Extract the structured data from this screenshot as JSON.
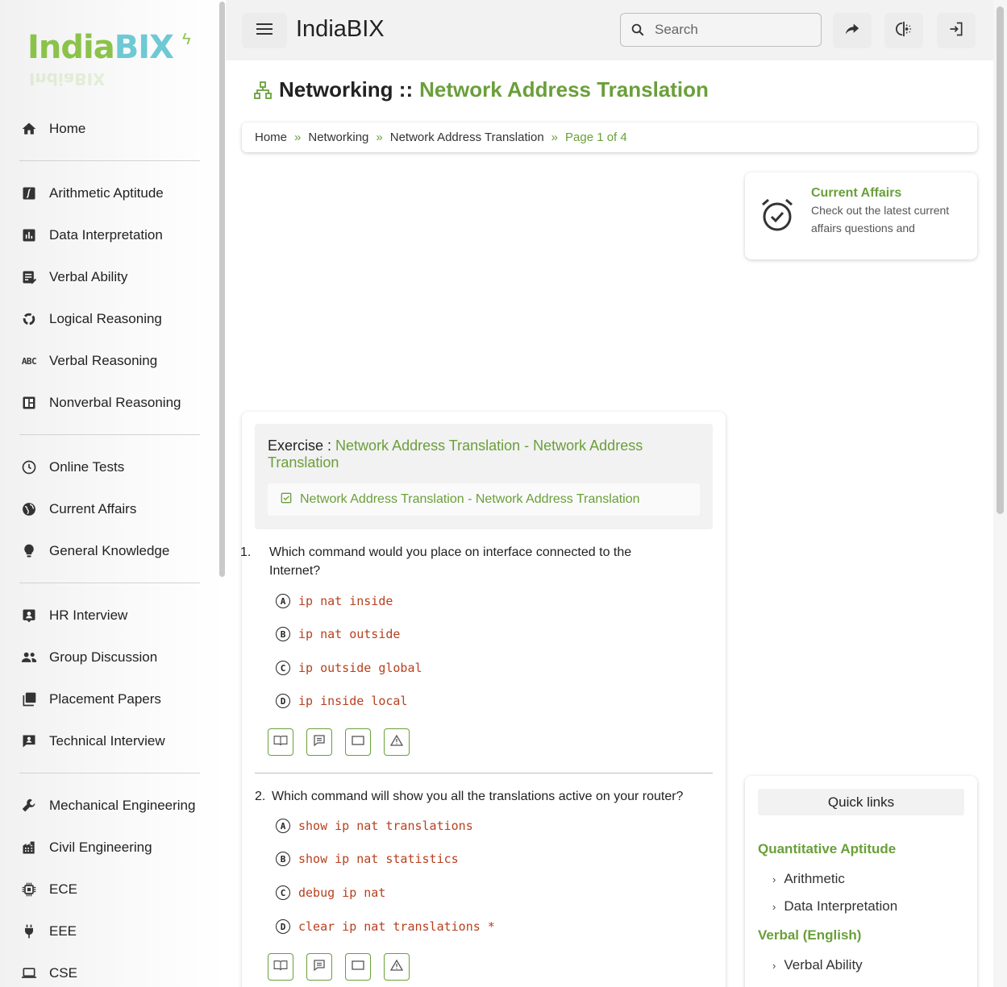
{
  "brand": {
    "logo_part1": "India",
    "logo_part2": "BIX",
    "name": "IndiaBIX"
  },
  "search": {
    "placeholder": "Search"
  },
  "sidebar": {
    "groups": [
      [
        {
          "label": "Home",
          "icon": "home-icon"
        }
      ],
      [
        {
          "label": "Arithmetic Aptitude",
          "icon": "function-icon"
        },
        {
          "label": "Data Interpretation",
          "icon": "bar-chart-icon"
        },
        {
          "label": "Verbal Ability",
          "icon": "checklist-icon"
        },
        {
          "label": "Logical Reasoning",
          "icon": "cycle-icon"
        },
        {
          "label": "Verbal Reasoning",
          "icon": "abc-icon"
        },
        {
          "label": "Nonverbal Reasoning",
          "icon": "dashboard-icon"
        }
      ],
      [
        {
          "label": "Online Tests",
          "icon": "clock-icon"
        },
        {
          "label": "Current Affairs",
          "icon": "globe-icon"
        },
        {
          "label": "General Knowledge",
          "icon": "lightbulb-icon"
        }
      ],
      [
        {
          "label": "HR Interview",
          "icon": "contact-icon"
        },
        {
          "label": "Group Discussion",
          "icon": "group-icon"
        },
        {
          "label": "Placement Papers",
          "icon": "library-icon"
        },
        {
          "label": "Technical Interview",
          "icon": "interview-icon"
        }
      ],
      [
        {
          "label": "Mechanical Engineering",
          "icon": "wrench-icon"
        },
        {
          "label": "Civil Engineering",
          "icon": "building-icon"
        },
        {
          "label": "ECE",
          "icon": "chip-icon"
        },
        {
          "label": "EEE",
          "icon": "plug-icon"
        },
        {
          "label": "CSE",
          "icon": "laptop-icon"
        }
      ]
    ]
  },
  "page": {
    "title_prefix": "Networking ::",
    "title_topic": "Network Address Translation",
    "breadcrumb": [
      "Home",
      "Networking",
      "Network Address Translation",
      "Page 1 of 4"
    ]
  },
  "current_affairs": {
    "title": "Current Affairs",
    "description": "Check out the latest current affairs questions and"
  },
  "exercise": {
    "label": "Exercise :",
    "name": "Network Address Translation - Network Address Translation",
    "chip": "Network Address Translation - Network Address Translation"
  },
  "questions": [
    {
      "number": "1.",
      "text": "Which command would you place on interface connected to the Internet?",
      "options": [
        {
          "letter": "A",
          "text": "ip nat inside"
        },
        {
          "letter": "B",
          "text": "ip nat outside"
        },
        {
          "letter": "C",
          "text": "ip outside global"
        },
        {
          "letter": "D",
          "text": "ip inside local"
        }
      ]
    },
    {
      "number": "2.",
      "text": "Which command will show you all the translations active on your router?",
      "options": [
        {
          "letter": "A",
          "text": "show ip nat translations"
        },
        {
          "letter": "B",
          "text": "show ip nat statistics"
        },
        {
          "letter": "C",
          "text": "debug ip nat"
        },
        {
          "letter": "D",
          "text": "clear ip nat translations *"
        }
      ]
    }
  ],
  "quick_links": {
    "title": "Quick links",
    "sections": [
      {
        "name": "Quantitative Aptitude",
        "links": [
          "Arithmetic",
          "Data Interpretation"
        ]
      },
      {
        "name": "Verbal (English)",
        "links": [
          "Verbal Ability"
        ]
      }
    ]
  },
  "colors": {
    "accent": "#6a9f3a",
    "code": "#b8401f",
    "logo_green": "#8bc34a",
    "logo_cyan": "#6ec9d4"
  }
}
